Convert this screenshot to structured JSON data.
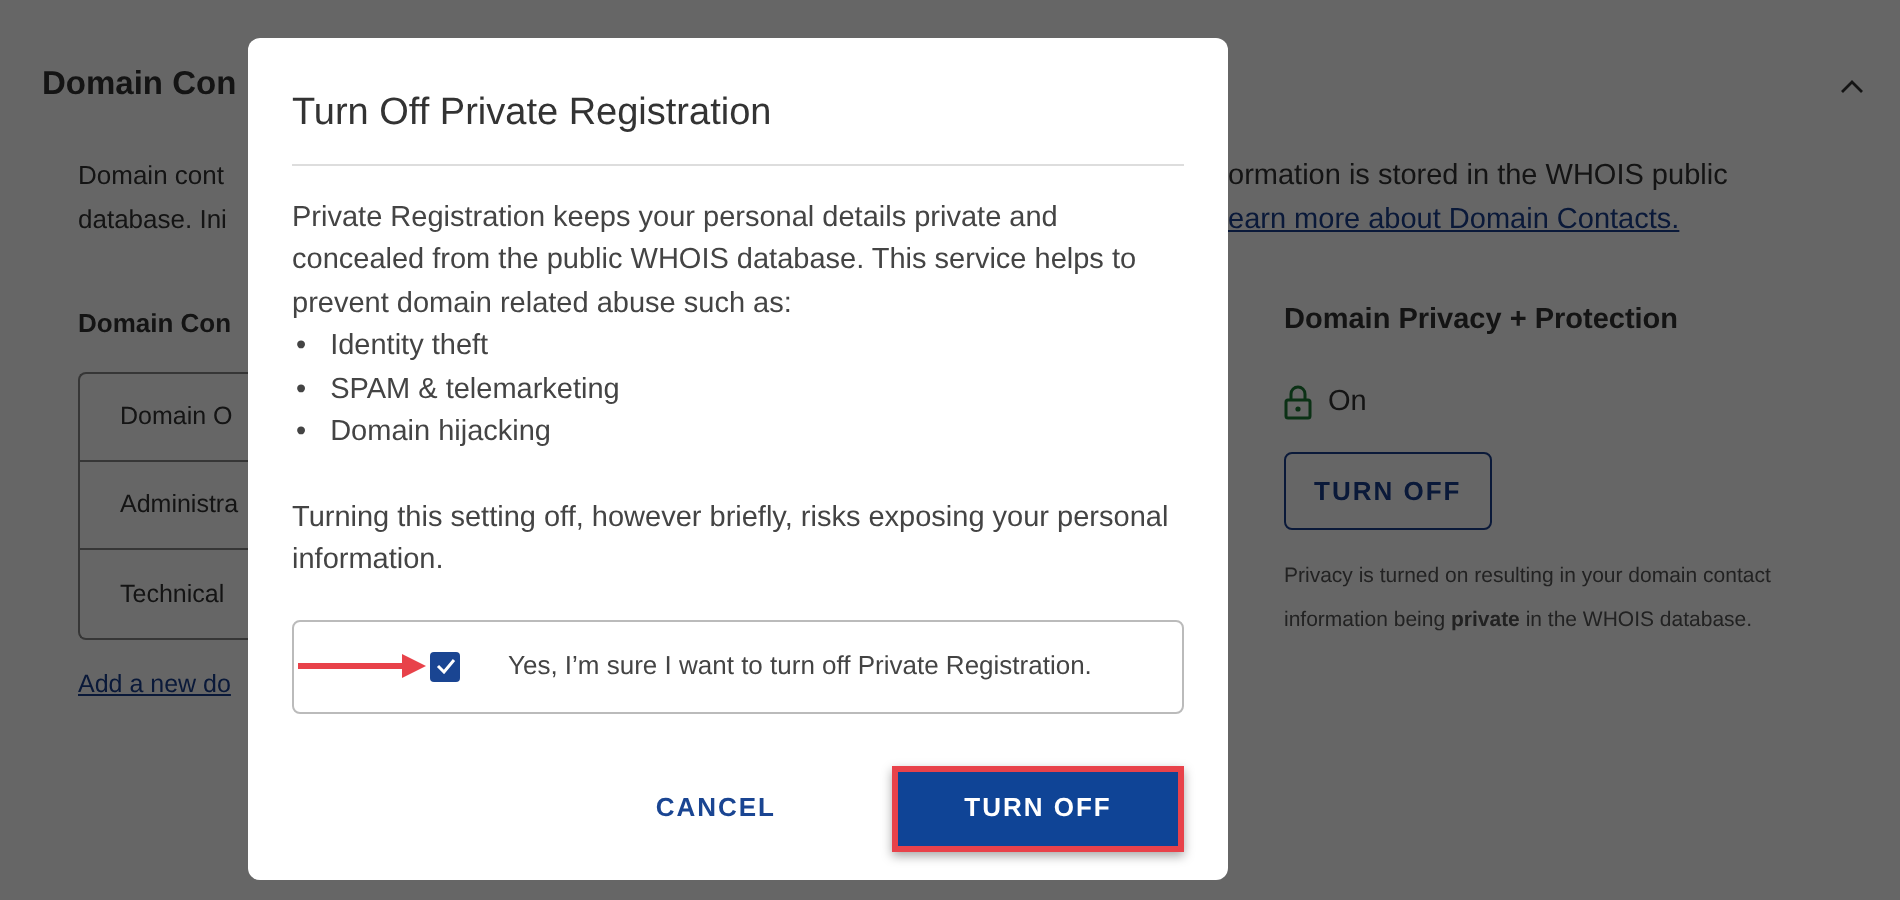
{
  "page": {
    "title": "Domain Con",
    "expanded": true,
    "intro_left": [
      "Domain cont",
      "database. Ini"
    ],
    "intro_right": "ormation is stored in the WHOIS public",
    "intro_link": "earn more about Domain Contacts.",
    "contacts_heading": "Domain Con",
    "contacts": [
      "Domain O",
      "Administra",
      "Technical"
    ],
    "add_link": "Add a new do",
    "privacy": {
      "heading": "Domain Privacy + Protection",
      "status": "On",
      "locked": true,
      "button": "TURN OFF",
      "note": "Privacy is turned on resulting in your domain contact information being **private** in the WHOIS database."
    }
  },
  "dialog": {
    "title": "Turn Off Private Registration",
    "intro": "Private Registration keeps your personal details private and concealed from the public WHOIS database. This service helps to prevent domain related abuse such as:",
    "bullet_marker": "•",
    "bullets": [
      "Identity theft",
      "SPAM & telemarketing",
      "Domain hijacking"
    ],
    "warning": "Turning this setting off, however briefly, risks exposing your personal information.",
    "confirm": {
      "label": "Yes, I’m sure I want to turn off Private Registration.",
      "checked": true,
      "pointer_arrow": true
    },
    "buttons": [
      {
        "label": "CANCEL",
        "kind": "text",
        "highlighted": false
      },
      {
        "label": "TURN OFF",
        "kind": "primary",
        "highlighted": true
      }
    ]
  }
}
